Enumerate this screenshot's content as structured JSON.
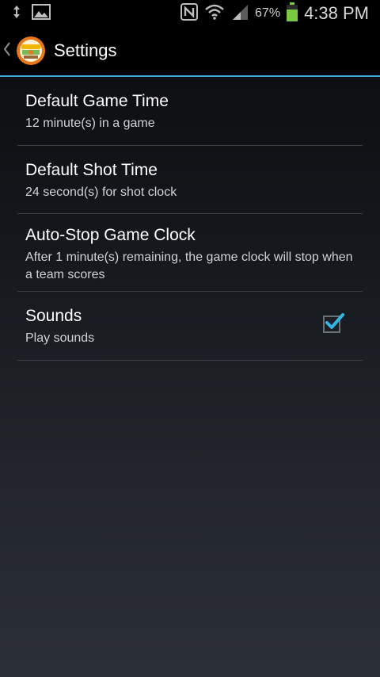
{
  "status_bar": {
    "battery_percent": "67%",
    "time": "4:38 PM"
  },
  "action_bar": {
    "title": "Settings"
  },
  "settings": [
    {
      "title": "Default Game Time",
      "summary": "12 minute(s) in a game"
    },
    {
      "title": "Default Shot Time",
      "summary": "24 second(s) for shot clock"
    },
    {
      "title": "Auto-Stop Game Clock",
      "summary": "After 1 minute(s) remaining, the game clock will stop when a team scores"
    },
    {
      "title": "Sounds",
      "summary": "Play sounds",
      "checked": true
    }
  ],
  "colors": {
    "accent": "#3aa6d8",
    "status_bar_bg": "#000000",
    "battery_green": "#7ac943"
  },
  "icons": {
    "status_left": [
      "usb-transfer-icon",
      "image-icon"
    ],
    "status_right": [
      "nfc-icon",
      "wifi-icon",
      "signal-icon",
      "battery-icon"
    ],
    "action_bar": [
      "up-chevron-icon",
      "app-logo-icon"
    ]
  }
}
